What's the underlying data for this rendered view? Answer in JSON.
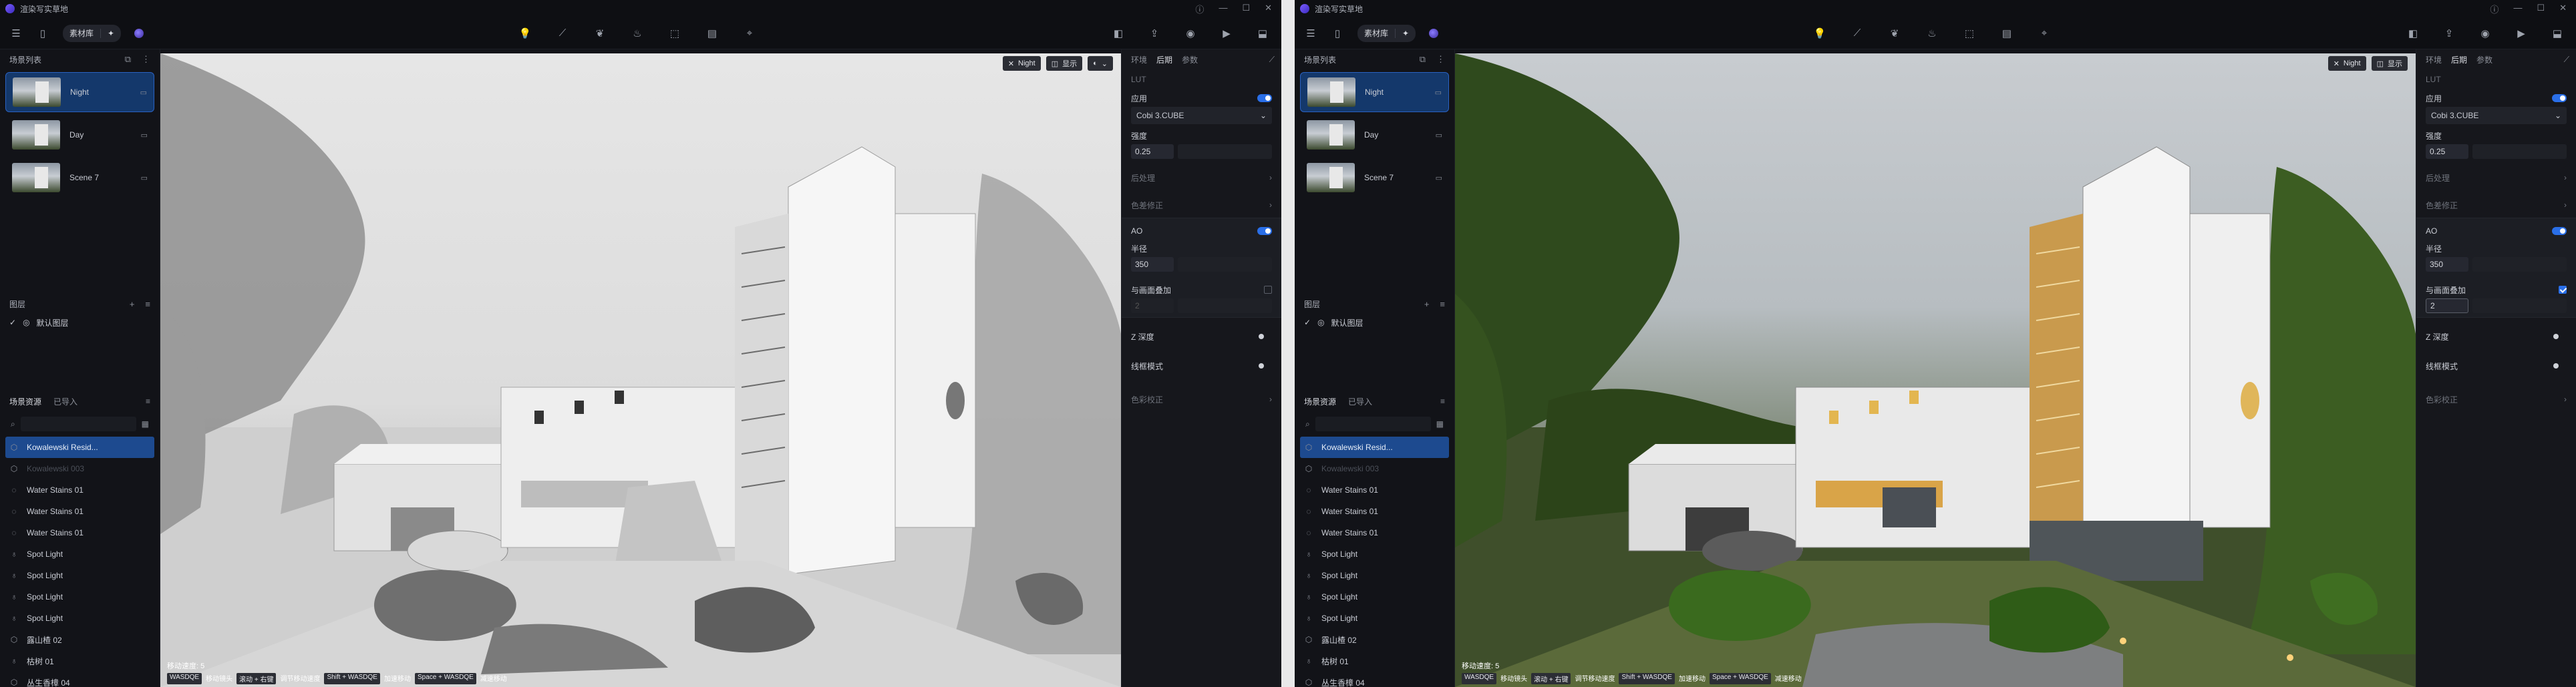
{
  "app": {
    "title": "渲染写实草地",
    "mode_label": "素材库",
    "accent": "#2a6fe8"
  },
  "toolbar": {
    "center_icons": [
      "lightbulb-icon",
      "cable-icon",
      "leaf-icon",
      "flame-icon",
      "box-import-icon",
      "film-icon",
      "pointer-icon"
    ],
    "right_icons": [
      "camera-icon",
      "export-icon",
      "photo-icon",
      "video-icon",
      "save-icon"
    ]
  },
  "scenes": {
    "header": "场景列表",
    "items": [
      {
        "name": "Night",
        "active": true
      },
      {
        "name": "Day",
        "active": false
      },
      {
        "name": "Scene 7",
        "active": false
      }
    ]
  },
  "layers": {
    "header": "图层",
    "items": [
      {
        "name": "默认图层"
      }
    ]
  },
  "assets": {
    "tab_active": "场景资源",
    "tab_other": "已导入",
    "items": [
      {
        "name": "Kowalewski Resid...",
        "selected": true,
        "dim": false,
        "icon": "cube-icon"
      },
      {
        "name": "Kowalewski 003",
        "selected": false,
        "dim": true,
        "icon": "cube-icon"
      },
      {
        "name": "Water Stains 01",
        "selected": false,
        "dim": false,
        "icon": "drop-icon"
      },
      {
        "name": "Water Stains 01",
        "selected": false,
        "dim": false,
        "icon": "drop-icon"
      },
      {
        "name": "Water Stains 01",
        "selected": false,
        "dim": false,
        "icon": "drop-icon"
      },
      {
        "name": "Spot Light",
        "selected": false,
        "dim": false,
        "icon": "bulb-icon"
      },
      {
        "name": "Spot Light",
        "selected": false,
        "dim": false,
        "icon": "bulb-icon"
      },
      {
        "name": "Spot Light",
        "selected": false,
        "dim": false,
        "icon": "bulb-icon"
      },
      {
        "name": "Spot Light",
        "selected": false,
        "dim": false,
        "icon": "bulb-icon"
      },
      {
        "name": "露山楂 02",
        "selected": false,
        "dim": false,
        "icon": "cube-icon"
      },
      {
        "name": "枯树 01",
        "selected": false,
        "dim": false,
        "icon": "bulb-icon"
      },
      {
        "name": "丛生香樟 04",
        "selected": false,
        "dim": false,
        "icon": "cube-icon"
      }
    ]
  },
  "viewport": {
    "hud": {
      "mode": "Night",
      "display": "显示"
    },
    "status": "移动速度: 5",
    "keys": [
      {
        "k": "WASDQE",
        "v": "移动镜头"
      },
      {
        "k": "滚动 + 右键",
        "v": "调节移动速度"
      },
      {
        "k": "Shift + WASDQE",
        "v": "加速移动"
      },
      {
        "k": "Space + WASDQE",
        "v": "减速移动"
      }
    ]
  },
  "panel": {
    "tabs": [
      "环境",
      "后期",
      "参数"
    ],
    "active_tab": "后期",
    "lut": {
      "title": "LUT",
      "apply_label": "应用",
      "file": "Cobi 3.CUBE",
      "strength_label": "强度",
      "strength": "0.25"
    },
    "section_bloom": "后处理",
    "section_ca": "色差修正",
    "ao": {
      "title": "AO",
      "radius_label": "半径",
      "radius": "350",
      "blend_label": "与画面叠加",
      "blend": "2"
    },
    "z_depth_label": "Z 深度",
    "wireframe_label": "线框模式",
    "section_color": "色彩校正"
  },
  "right_app": {
    "blend_checked": true
  }
}
